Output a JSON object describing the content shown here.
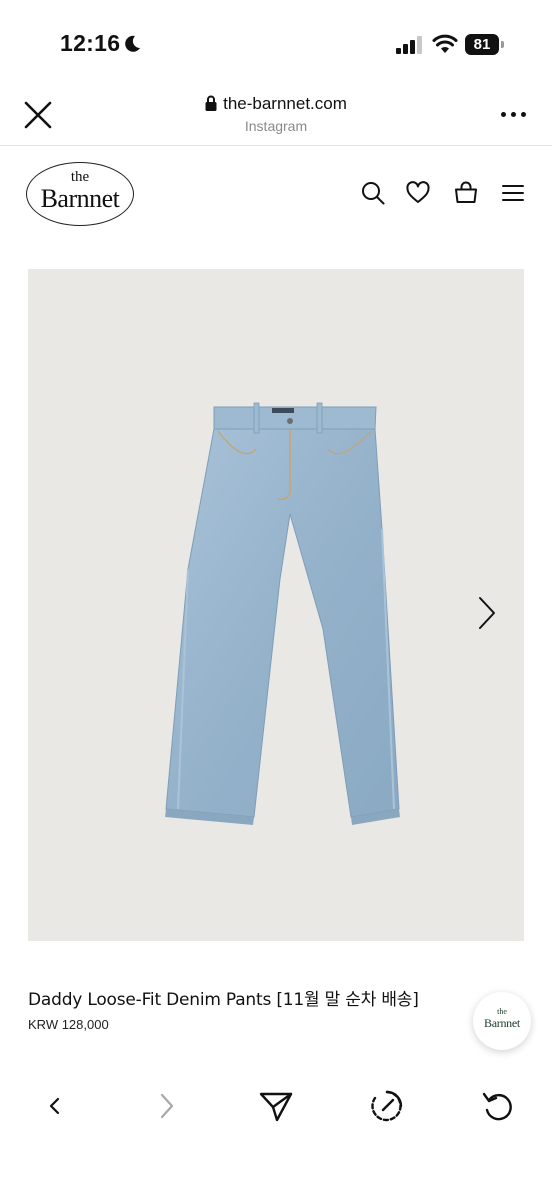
{
  "status_bar": {
    "time": "12:16",
    "battery": "81",
    "icons": [
      "moon-icon",
      "signal-icon",
      "wifi-icon",
      "battery-icon"
    ]
  },
  "browser": {
    "url": "the-barnnet.com",
    "source": "Instagram",
    "icons": [
      "close-icon",
      "lock-icon",
      "more-icon"
    ]
  },
  "site": {
    "logo_small": "the",
    "logo_big": "Barnnet",
    "nav_icons": [
      "search-icon",
      "heart-icon",
      "bag-icon",
      "menu-icon"
    ]
  },
  "product": {
    "image_icon": "jeans-image",
    "title": "Daddy Loose-Fit Denim Pants [11월 말 순차 배송]",
    "price": "KRW 128,000",
    "next_icon": "chevron-right-icon"
  },
  "chat_widget": {
    "logo_small": "the",
    "logo_big": "Barnnet"
  },
  "toolbar": {
    "icons": [
      "back-icon",
      "forward-icon",
      "share-icon",
      "speed-icon",
      "reload-icon"
    ]
  },
  "colors": {
    "image_background": "#e9e8e5",
    "denim": "#9cb8d0",
    "text": "#111111",
    "muted": "#8a8a8a"
  }
}
